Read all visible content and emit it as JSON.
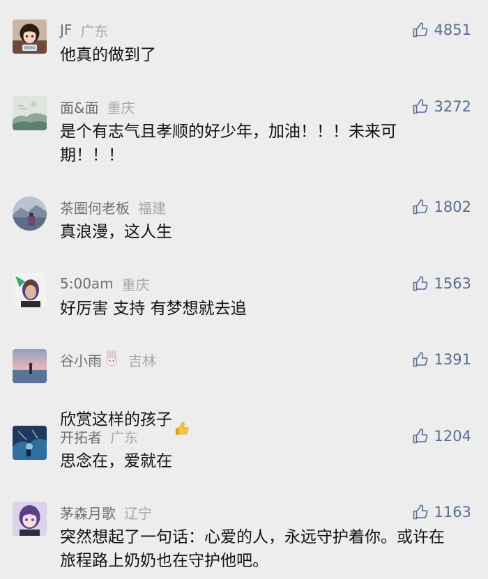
{
  "comments": [
    {
      "nickname": "JF",
      "location": "广东",
      "likes": "4851",
      "text": "他真的做到了",
      "avatar_icon": "anime-girl-avatar"
    },
    {
      "nickname": "面&面",
      "location": "重庆",
      "likes": "3272",
      "text": "是个有志气且孝顺的好少年，加油！！！未来可\n期！！！",
      "avatar_icon": "landscape-painting-avatar"
    },
    {
      "nickname": "茶圈何老板",
      "location": "福建",
      "likes": "1802",
      "text": "真浪漫，这人生",
      "avatar_icon": "lake-mountain-avatar"
    },
    {
      "nickname": "5:00am",
      "location": "重庆",
      "likes": "1563",
      "text": "好厉害 支持 有梦想就去追",
      "avatar_icon": "portrait-avatar"
    },
    {
      "nickname": "谷小雨",
      "location": "吉林",
      "likes": "1391",
      "text": "欣赏这样的孩子",
      "avatar_icon": "sunset-beach-avatar",
      "nickname_emoji": "rabbit-emoji",
      "text_emoji": "thumbs-up-emoji"
    },
    {
      "nickname": "开拓者",
      "location": "广东",
      "likes": "1204",
      "text": "思念在，爱就在",
      "avatar_icon": "blue-storm-avatar"
    },
    {
      "nickname": "茅森月歌",
      "location": "辽宁",
      "likes": "1163",
      "text": "突然想起了一句话：心爱的人，永远守护着你。或许在\n旅程路上奶奶也在守护他吧。",
      "avatar_icon": "anime-purple-hair-avatar"
    }
  ]
}
